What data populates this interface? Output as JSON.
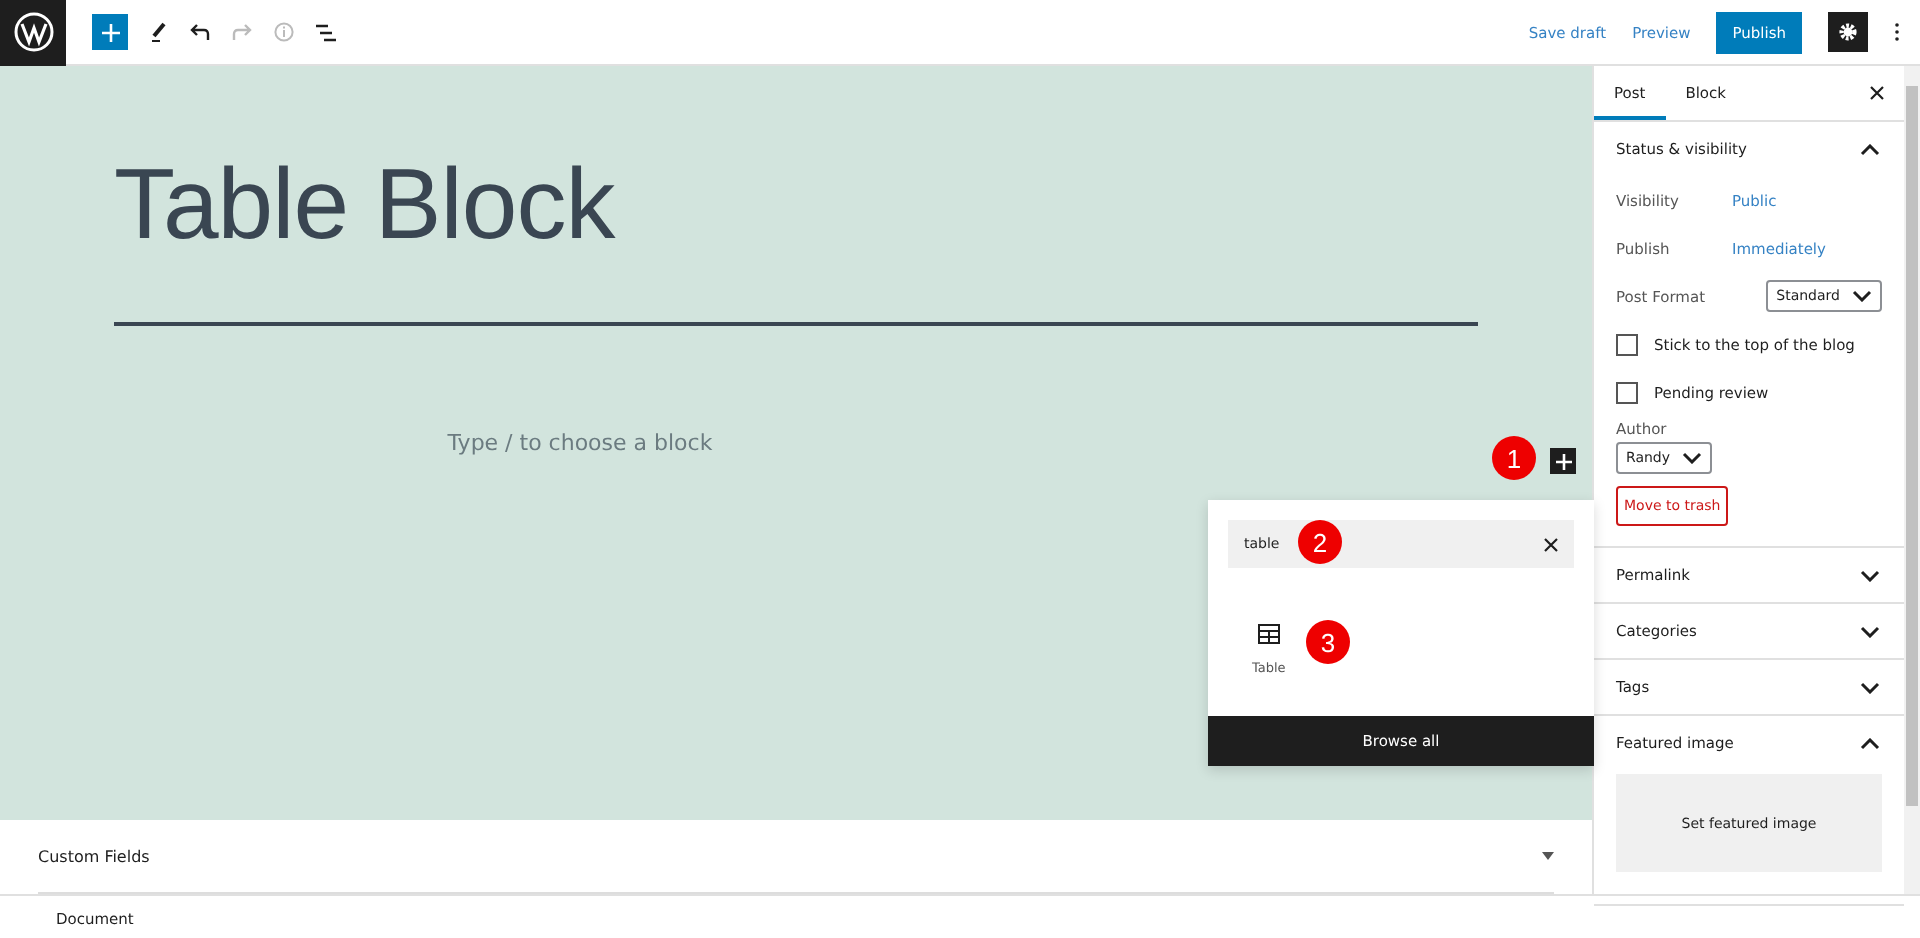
{
  "toolbar": {
    "save_draft": "Save draft",
    "preview": "Preview",
    "publish": "Publish",
    "settings_active": true
  },
  "editor": {
    "title": "Table Block",
    "placeholder": "Type / to choose a block"
  },
  "markers": [
    "1",
    "2",
    "3"
  ],
  "inserter": {
    "search": {
      "value": "table"
    },
    "results": [
      {
        "label": "Table"
      }
    ],
    "browse_all": "Browse all"
  },
  "sidebar": {
    "tabs": [
      {
        "label": "Post",
        "selected": true
      },
      {
        "label": "Block",
        "selected": false
      }
    ],
    "panels": [
      {
        "kind": "status",
        "title": "Status & visibility",
        "expanded": true,
        "rows": [
          {
            "label": "Visibility",
            "value": "Public"
          },
          {
            "label": "Publish",
            "value": "Immediately"
          }
        ],
        "post_format": {
          "label": "Post Format",
          "value": "Standard"
        },
        "checkboxes": [
          {
            "label": "Stick to the top of the blog",
            "checked": false
          },
          {
            "label": "Pending review",
            "checked": false
          }
        ],
        "author": {
          "label": "Author",
          "value": "Randy"
        },
        "trash": "Move to trash"
      },
      {
        "title": "Permalink",
        "expanded": false
      },
      {
        "title": "Categories",
        "expanded": false
      },
      {
        "title": "Tags",
        "expanded": false
      },
      {
        "kind": "featured",
        "title": "Featured image",
        "expanded": true,
        "button": "Set featured image"
      }
    ]
  },
  "meta_boxes": [
    {
      "title": "Custom Fields",
      "expanded": false
    }
  ],
  "footer": "Document"
}
